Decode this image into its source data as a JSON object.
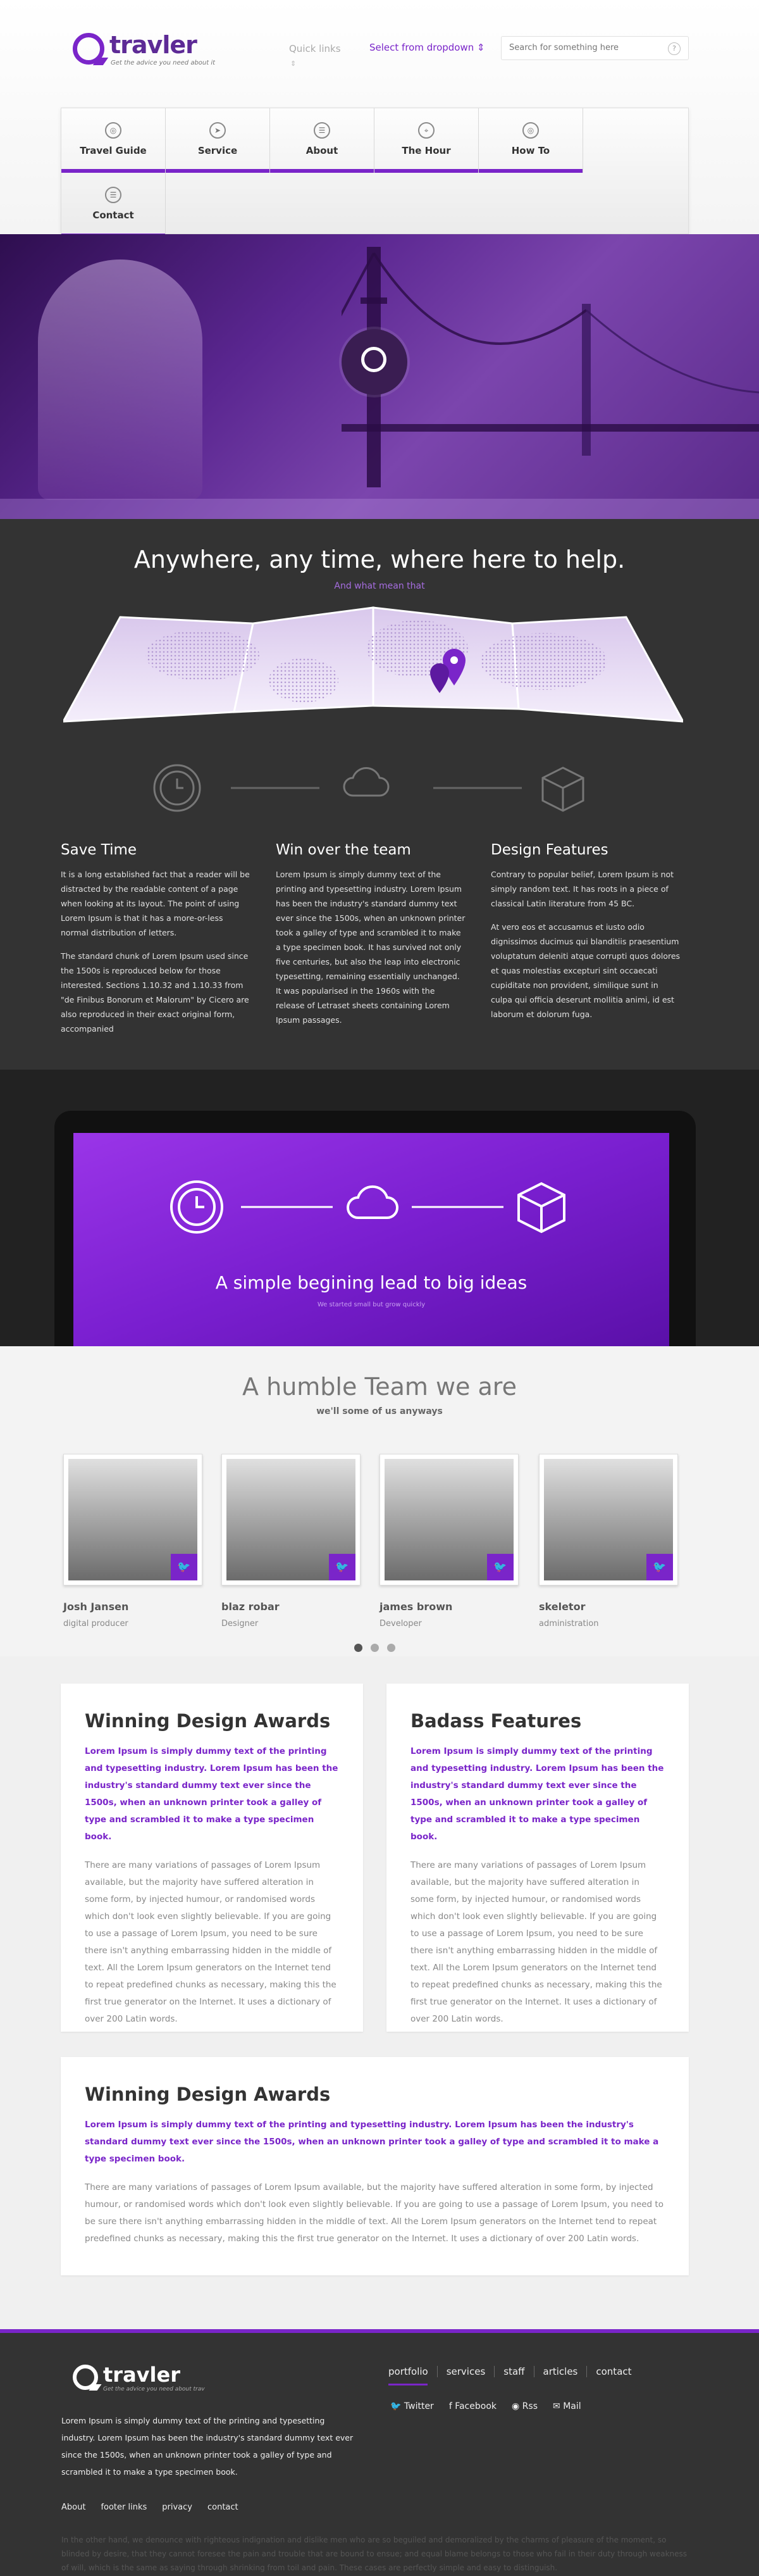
{
  "header": {
    "brand": "travler",
    "tagline": "Get the advice you need about it",
    "quick_links": "Quick links",
    "quick_arrow": "⇕",
    "dropdown": "Select from dropdown",
    "dropdown_caret": "⇕",
    "search_placeholder": "Search for something here"
  },
  "nav": {
    "items": [
      {
        "label": "Travel Guide",
        "icon": "globe-icon",
        "glyph": "◎"
      },
      {
        "label": "Service",
        "icon": "paper-plane-icon",
        "glyph": "➤"
      },
      {
        "label": "About",
        "icon": "document-icon",
        "glyph": "☰"
      },
      {
        "label": "The Hour",
        "icon": "location-pin-icon",
        "glyph": "⌖"
      },
      {
        "label": "How To",
        "icon": "globe-icon",
        "glyph": "◎"
      },
      {
        "label": "Contact",
        "icon": "document-icon",
        "glyph": "☰"
      }
    ]
  },
  "intro": {
    "title": "Anywhere, any time, where here to help.",
    "subtitle": "And what mean that"
  },
  "features": [
    {
      "title": "Save Time",
      "paragraphs": [
        "It is a long established fact that a reader will be distracted by the readable content of a page when looking at its layout. The point of using Lorem Ipsum is that it has a more-or-less normal distribution of letters.",
        "The standard chunk of Lorem Ipsum used since the 1500s is reproduced below for those interested. Sections 1.10.32 and 1.10.33 from \"de Finibus Bonorum et Malorum\" by Cicero are also reproduced in their exact original form, accompanied"
      ]
    },
    {
      "title": "Win over the team",
      "paragraphs": [
        "Lorem Ipsum is simply dummy text of the printing and typesetting industry. Lorem Ipsum has been the industry's standard dummy text ever since the 1500s, when an unknown printer took a galley of type and scrambled it to make a type specimen book. It has survived not only five centuries, but also the leap into electronic typesetting, remaining essentially unchanged. It was popularised in the 1960s with the release of Letraset sheets containing Lorem Ipsum passages."
      ]
    },
    {
      "title": "Design Features",
      "paragraphs": [
        "Contrary to popular belief, Lorem Ipsum is not simply random text. It has roots in a piece of classical Latin literature from 45 BC.",
        "At vero eos et accusamus et iusto odio dignissimos ducimus qui blanditiis praesentium voluptatum deleniti atque corrupti quos dolores et quas molestias excepturi sint occaecati cupiditate non provident, similique sunt in culpa qui officia deserunt mollitia animi, id est laborum et dolorum fuga."
      ]
    }
  ],
  "laptop": {
    "title": "A simple begining lead to big ideas",
    "subtitle": "We started small but grow quickly"
  },
  "team": {
    "title": "A humble Team we are",
    "subtitle": "we'll some of us anyways",
    "twitter_glyph": "🐦",
    "members": [
      {
        "name": "Josh Jansen",
        "role": "digital producer"
      },
      {
        "name": "blaz robar",
        "role": "Designer"
      },
      {
        "name": "james brown",
        "role": "Developer"
      },
      {
        "name": "skeletor",
        "role": "administration"
      }
    ]
  },
  "box1": {
    "title": "Winning Design Awards",
    "lead": "Lorem Ipsum is simply dummy text of the printing and typesetting industry. Lorem Ipsum has been the industry's standard dummy text ever since the 1500s, when an unknown printer took a galley of type and scrambled it to make a type specimen book.",
    "body": "There are many variations of passages of Lorem Ipsum available, but the majority have suffered alteration in some form, by injected humour, or randomised words which don't look even slightly believable. If you are going to use a passage of Lorem Ipsum, you need to be sure there isn't anything embarrassing hidden in the middle of text. All the Lorem Ipsum generators on the Internet tend to repeat predefined chunks as necessary, making this the first true generator on the Internet. It uses a dictionary of over 200 Latin words."
  },
  "box2": {
    "title": "Badass Features",
    "lead": "Lorem Ipsum is simply dummy text of the printing and typesetting industry. Lorem Ipsum has been the industry's standard dummy text ever since the 1500s, when an unknown printer took a galley of type and scrambled it to make a type specimen book.",
    "body": "There are many variations of passages of Lorem Ipsum available, but the majority have suffered alteration in some form, by injected humour, or randomised words which don't look even slightly believable. If you are going to use a passage of Lorem Ipsum, you need to be sure there isn't anything embarrassing hidden in the middle of text. All the Lorem Ipsum generators on the Internet tend to repeat predefined chunks as necessary, making this the first true generator on the Internet. It uses a dictionary of over 200 Latin words."
  },
  "box3": {
    "title": "Winning Design Awards",
    "lead": "Lorem Ipsum is simply dummy text of the printing and typesetting industry. Lorem Ipsum has been the industry's standard dummy text ever since the 1500s, when an unknown printer took a galley of type and scrambled it to make a type specimen book.",
    "body": "There are many variations of passages of Lorem Ipsum available, but the majority have suffered alteration in some form, by injected humour, or randomised words which don't look even slightly believable. If you are going to use a passage of Lorem Ipsum, you need to be sure there isn't anything embarrassing hidden in the middle of text. All the Lorem Ipsum generators on the Internet tend to repeat predefined chunks as necessary, making this the first true generator on the Internet. It uses a dictionary of over 200 Latin words."
  },
  "footer": {
    "brand": "travler",
    "tagline": "Get the advice you need about trav",
    "description": "Lorem Ipsum is simply dummy text of the printing and typesetting industry. Lorem Ipsum has been the industry's standard dummy text ever since the 1500s, when an unknown printer took a galley of type and scrambled it to make a type specimen book.",
    "menu": [
      "portfolio",
      "services",
      "staff",
      "articles",
      "contact"
    ],
    "social": [
      {
        "glyph": "🐦",
        "label": "Twitter"
      },
      {
        "glyph": "f",
        "label": "Facebook"
      },
      {
        "glyph": "◉",
        "label": "Rss"
      },
      {
        "glyph": "✉",
        "label": "Mail"
      }
    ],
    "links": [
      "About",
      "footer links",
      "privacy",
      "contact"
    ],
    "legal": "In the other hand, we denounce with righteous indignation and dislike men who are so beguiled and demoralized by the charms of pleasure of the moment, so blinded by desire, that they cannot foresee the pain and trouble that are bound to ensue; and equal blame belongs to those who fail in their duty through weakness of will, which is the same as saying through shrinking from toil and pain. These cases are perfectly simple and easy to distinguish."
  },
  "colors": {
    "accent": "#7a25c9",
    "dark": "#333333",
    "screen": "#7a1fd0"
  }
}
